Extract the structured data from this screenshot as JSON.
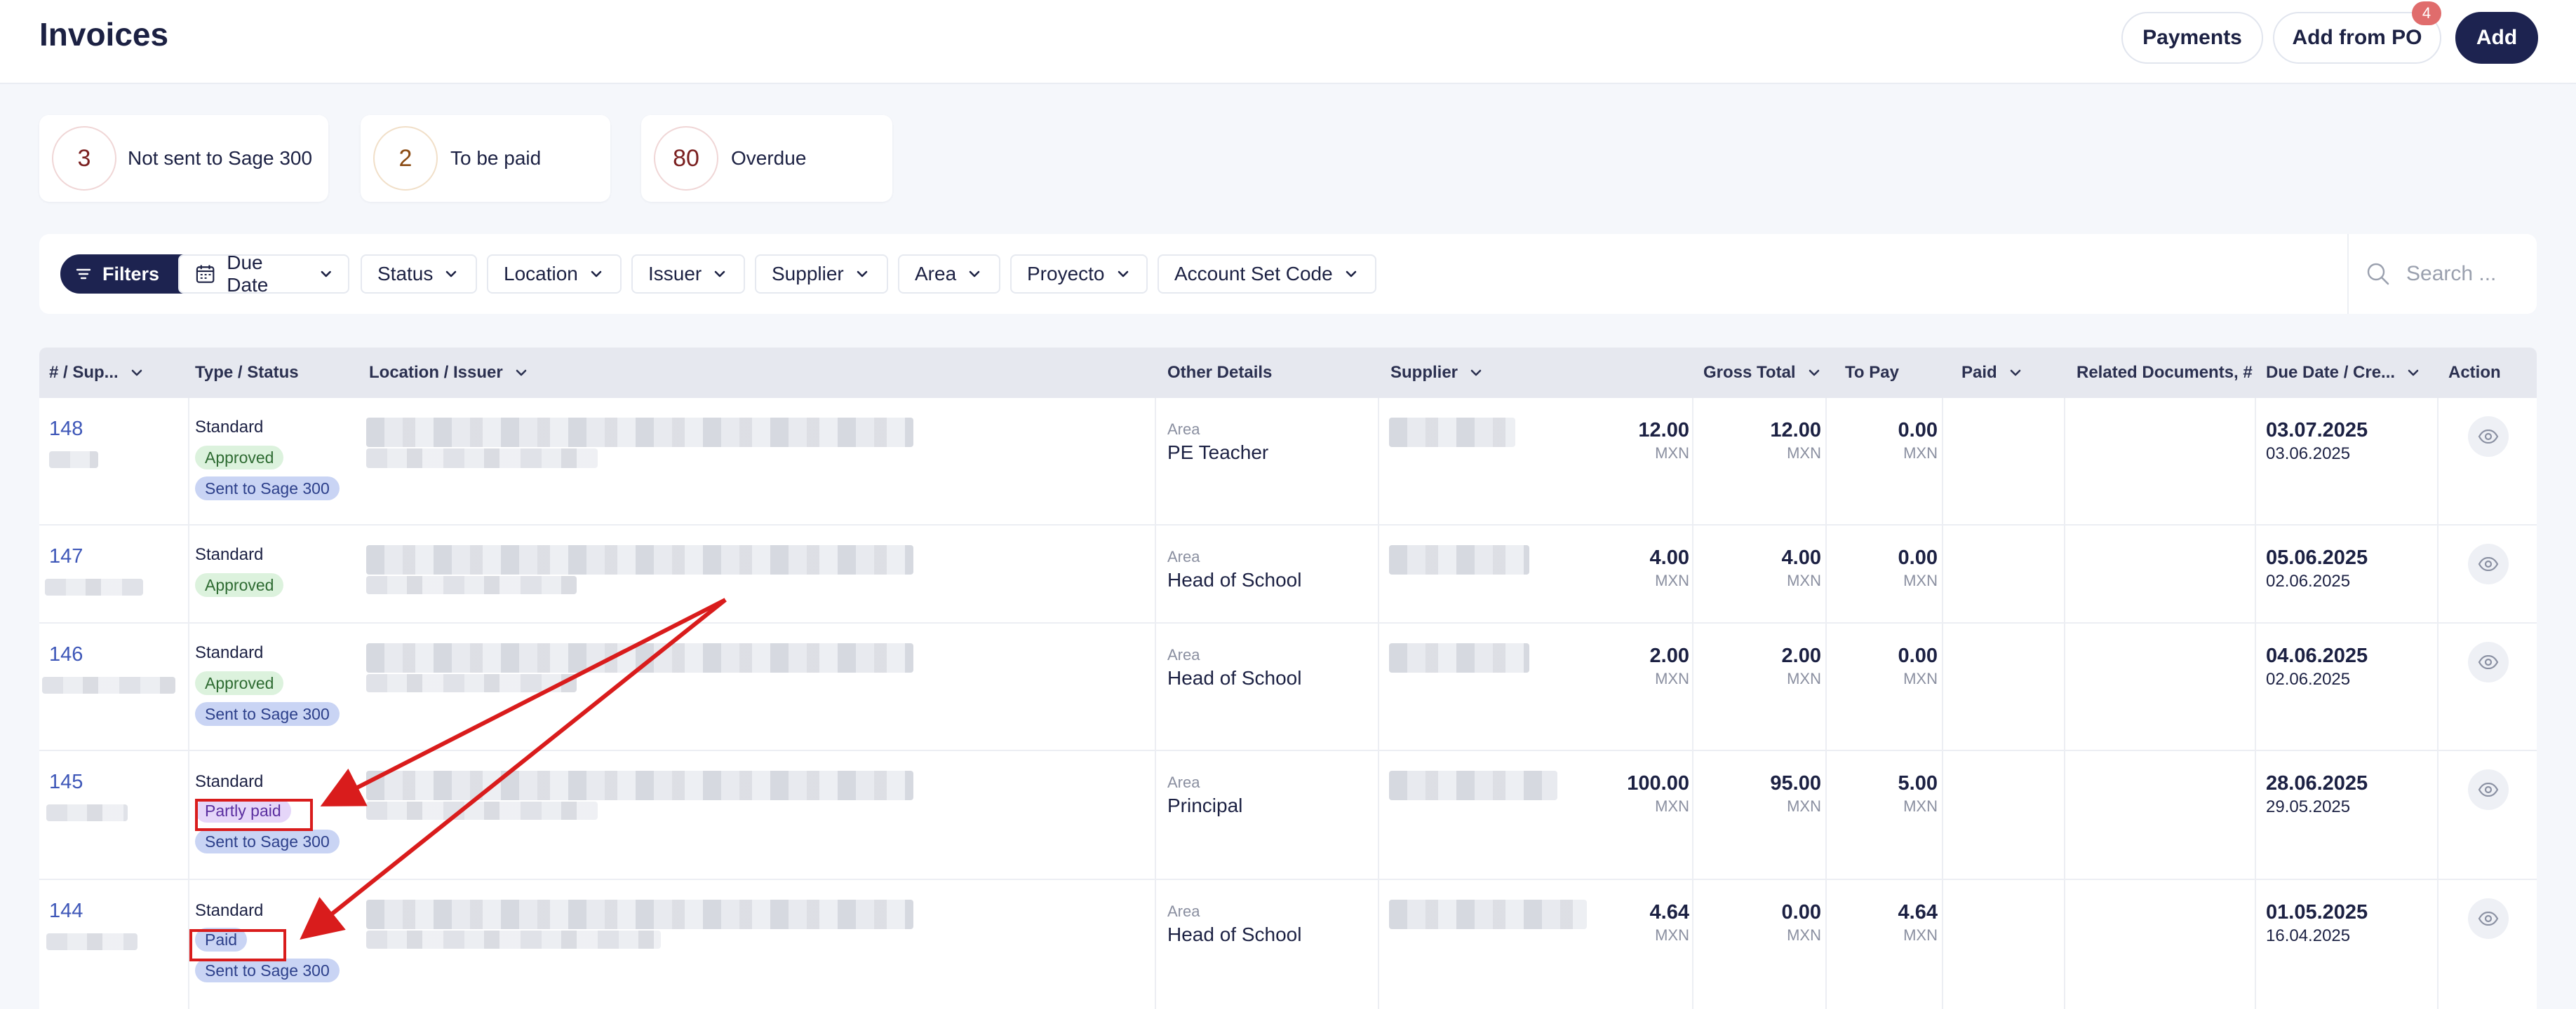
{
  "header": {
    "title": "Invoices",
    "payments_label": "Payments",
    "add_from_po_label": "Add from PO",
    "add_from_po_badge": "4",
    "add_label": "Add"
  },
  "summary": {
    "not_sent": {
      "count": "3",
      "label": "Not sent to Sage 300"
    },
    "to_be_paid": {
      "count": "2",
      "label": "To be paid"
    },
    "overdue": {
      "count": "80",
      "label": "Overdue"
    }
  },
  "filters": {
    "filters_label": "Filters",
    "due_date": "Due Date",
    "status": "Status",
    "location": "Location",
    "issuer": "Issuer",
    "supplier": "Supplier",
    "area": "Area",
    "proyecto": "Proyecto",
    "account_set_code": "Account Set Code",
    "search_placeholder": "Search ..."
  },
  "table": {
    "columns": {
      "num": "# / Sup...",
      "type_status": "Type / Status",
      "location_issuer": "Location / Issuer",
      "other_details": "Other Details",
      "supplier": "Supplier",
      "gross_total": "Gross Total",
      "to_pay": "To Pay",
      "paid": "Paid",
      "related_documents": "Related Documents, #",
      "due_date": "Due Date / Cre...",
      "action": "Action"
    },
    "rows": [
      {
        "number": "148",
        "type": "Standard",
        "status1": "Approved",
        "status2": "Sent to Sage 300",
        "area_label": "Area",
        "area": "PE Teacher",
        "gross": "12.00",
        "to_pay": "12.00",
        "paid": "0.00",
        "currency": "MXN",
        "due": "03.07.2025",
        "created": "03.06.2025"
      },
      {
        "number": "147",
        "type": "Standard",
        "status1": "Approved",
        "status2": "",
        "area_label": "Area",
        "area": "Head of School",
        "gross": "4.00",
        "to_pay": "4.00",
        "paid": "0.00",
        "currency": "MXN",
        "due": "05.06.2025",
        "created": "02.06.2025"
      },
      {
        "number": "146",
        "type": "Standard",
        "status1": "Approved",
        "status2": "Sent to Sage 300",
        "area_label": "Area",
        "area": "Head of School",
        "gross": "2.00",
        "to_pay": "2.00",
        "paid": "0.00",
        "currency": "MXN",
        "due": "04.06.2025",
        "created": "02.06.2025"
      },
      {
        "number": "145",
        "type": "Standard",
        "status1": "Partly paid",
        "status2": "Sent to Sage 300",
        "area_label": "Area",
        "area": "Principal",
        "gross": "100.00",
        "to_pay": "95.00",
        "paid": "5.00",
        "currency": "MXN",
        "due": "28.06.2025",
        "created": "29.05.2025"
      },
      {
        "number": "144",
        "type": "Standard",
        "status1": "Paid",
        "status2": "Sent to Sage 300",
        "area_label": "Area",
        "area": "Head of School",
        "gross": "4.64",
        "to_pay": "0.00",
        "paid": "4.64",
        "currency": "MXN",
        "due": "01.05.2025",
        "created": "16.04.2025"
      }
    ]
  },
  "colors": {
    "primary": "#1d2350",
    "link": "#3e57b8",
    "annotation": "#d91c1c"
  },
  "icons": [
    "filter-lines-icon",
    "calendar-icon",
    "chevron-down-icon",
    "search-icon",
    "eye-icon"
  ]
}
